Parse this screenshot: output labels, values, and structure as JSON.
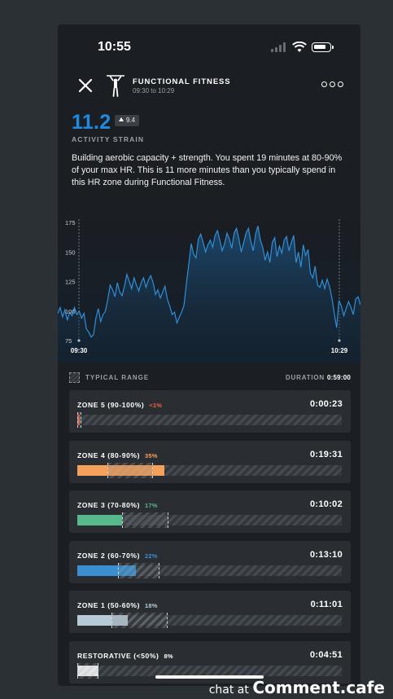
{
  "status_bar": {
    "time": "10:55"
  },
  "header": {
    "title": "FUNCTIONAL FITNESS",
    "time_range": "09:30 to 10:29"
  },
  "strain": {
    "value": "11.2",
    "delta": "9.4",
    "label": "ACTIVITY STRAIN",
    "color": "#1f8ae0"
  },
  "description": "Building aerobic capacity + strength. You spent 19 minutes at 80-90% of your max HR. This is 11 more minutes than you typically spend in this HR zone during Functional Fitness.",
  "chart_data": {
    "type": "line",
    "y_ticks": [
      "175",
      "150",
      "125",
      "100",
      "75"
    ],
    "ylim": [
      75,
      175
    ],
    "x_labels": [
      "09:30",
      "10:29"
    ],
    "line_color": "#2f8fd8",
    "x": [
      0,
      3,
      6,
      9,
      12,
      15,
      18,
      21,
      24,
      27,
      30,
      33,
      36,
      39,
      42,
      45,
      48,
      51,
      54,
      57,
      60,
      63,
      66,
      69
    ],
    "values": [
      98,
      93,
      101,
      97,
      81,
      78,
      101,
      122,
      113,
      128,
      121,
      128,
      116,
      107,
      98,
      145,
      165,
      153,
      168,
      160,
      144,
      166,
      150,
      122
    ],
    "series_values": [
      98,
      103,
      95,
      101,
      92,
      99,
      96,
      103,
      97,
      100,
      94,
      98,
      85,
      82,
      78,
      80,
      94,
      102,
      91,
      97,
      100,
      110,
      122,
      118,
      112,
      124,
      116,
      113,
      121,
      131,
      125,
      119,
      128,
      122,
      117,
      124,
      128,
      120,
      126,
      130,
      124,
      114,
      118,
      111,
      116,
      121,
      110,
      104,
      97,
      99,
      90,
      95,
      99,
      105,
      124,
      140,
      157,
      148,
      145,
      161,
      165,
      158,
      150,
      156,
      160,
      154,
      164,
      168,
      160,
      151,
      157,
      166,
      161,
      153,
      166,
      170,
      161,
      150,
      158,
      166,
      170,
      159,
      151,
      165,
      172,
      160,
      154,
      143,
      150,
      141,
      158,
      162,
      146,
      155,
      149,
      160,
      163,
      151,
      158,
      164,
      141,
      150,
      137,
      156,
      147,
      152,
      132,
      128,
      138,
      122,
      120,
      126,
      119,
      127,
      121,
      111,
      98,
      86,
      109,
      104,
      96,
      102,
      108,
      103,
      97,
      110,
      112,
      105
    ]
  },
  "legend": {
    "typical_range": "TYPICAL RANGE",
    "duration_label": "DURATION",
    "duration_value": "0:59:00"
  },
  "zones": [
    {
      "name": "ZONE 5 (90-100%)",
      "pct": "<1%",
      "time": "0:00:23",
      "color": "#e8673c",
      "fill": 0.01,
      "range": [
        0.0,
        0.015
      ]
    },
    {
      "name": "ZONE 4 (80-90%)",
      "pct": "35%",
      "time": "0:19:31",
      "color": "#f5a15c",
      "fill": 0.33,
      "range": [
        0.115,
        0.285
      ]
    },
    {
      "name": "ZONE 3 (70-80%)",
      "pct": "17%",
      "time": "0:10:02",
      "color": "#57b88b",
      "fill": 0.17,
      "range": [
        0.17,
        0.345
      ]
    },
    {
      "name": "ZONE 2 (60-70%)",
      "pct": "22%",
      "time": "0:13:10",
      "color": "#3a8fd0",
      "fill": 0.22,
      "range": [
        0.155,
        0.31
      ]
    },
    {
      "name": "ZONE 1 (50-60%)",
      "pct": "18%",
      "time": "0:11:01",
      "color": "#b8cad6",
      "fill": 0.19,
      "range": [
        0.13,
        0.34
      ]
    },
    {
      "name": "RESTORATIVE (<50%)",
      "pct": "8%",
      "time": "0:04:51",
      "color": "#ffffff",
      "fill": 0.08,
      "range": [
        0.0,
        0.08
      ]
    }
  ],
  "watermark": {
    "small": "chat at",
    "big": "Comment.cafe"
  }
}
